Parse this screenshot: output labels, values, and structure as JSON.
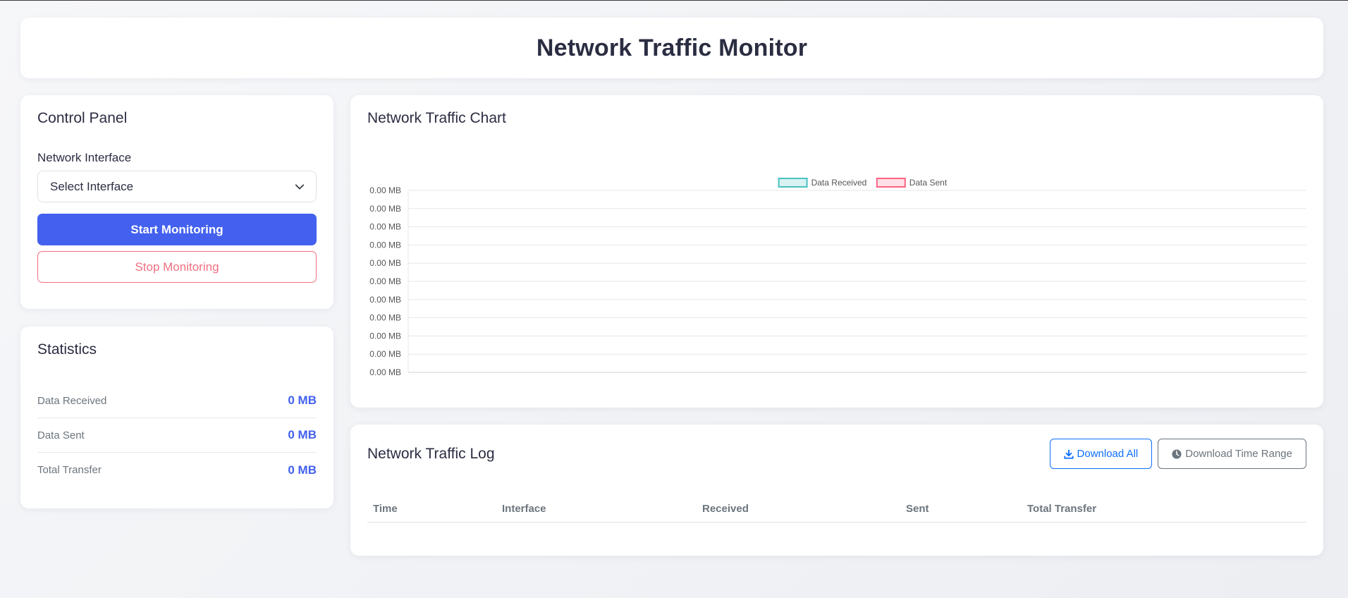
{
  "header": {
    "title": "Network Traffic Monitor"
  },
  "control_panel": {
    "title": "Control Panel",
    "interface_label": "Network Interface",
    "interface_select": {
      "selected": "Select Interface"
    },
    "start_label": "Start Monitoring",
    "stop_label": "Stop Monitoring"
  },
  "statistics": {
    "title": "Statistics",
    "rows": [
      {
        "label": "Data Received",
        "value": "0 MB"
      },
      {
        "label": "Data Sent",
        "value": "0 MB"
      },
      {
        "label": "Total Transfer",
        "value": "0 MB"
      }
    ]
  },
  "chart_panel": {
    "title": "Network Traffic Chart"
  },
  "chart_data": {
    "type": "line",
    "title": "",
    "xlabel": "",
    "ylabel": "",
    "x": [],
    "y_tick_labels": [
      "0.00 MB",
      "0.00 MB",
      "0.00 MB",
      "0.00 MB",
      "0.00 MB",
      "0.00 MB",
      "0.00 MB",
      "0.00 MB",
      "0.00 MB",
      "0.00 MB",
      "0.00 MB"
    ],
    "grid": true,
    "legend_position": "top-center",
    "series": [
      {
        "name": "Data Received",
        "values": [],
        "color": "#4bc0c0",
        "fill": "#d9f2f2"
      },
      {
        "name": "Data Sent",
        "values": [],
        "color": "#ff6384",
        "fill": "#ffe0e6"
      }
    ]
  },
  "log": {
    "title": "Network Traffic Log",
    "download_all_label": "Download All",
    "download_range_label": "Download Time Range",
    "columns": [
      "Time",
      "Interface",
      "Received",
      "Sent",
      "Total Transfer"
    ],
    "rows": []
  },
  "icons": {
    "select": "chevron-down-icon",
    "download_all": "download-icon",
    "download_range": "clock-icon"
  },
  "colors": {
    "primary": "#4361ee",
    "danger": "#ef6f80",
    "link_primary": "#0d6efd",
    "secondary": "#6c757d"
  }
}
